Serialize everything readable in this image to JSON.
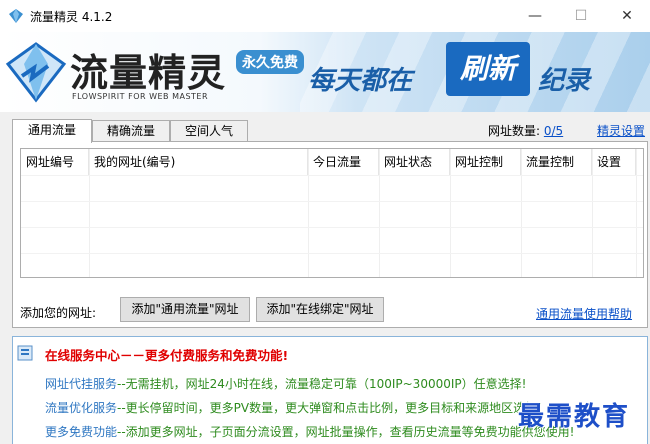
{
  "window": {
    "title": "流量精灵 4.1.2",
    "icon": "diamond-app-icon",
    "controls": {
      "minimize": "—",
      "maximize": "☐",
      "close": "✕"
    }
  },
  "banner": {
    "brand": "流量精灵",
    "subtitle": "FLOWSPIRIT FOR WEB MASTER",
    "free_badge": "永久免费",
    "slogan_a": "每天都在",
    "slogan_b": "刷新",
    "slogan_c": "纪录",
    "colors": {
      "brand_blue": "#1a6ac0",
      "accent": "#3a8fd0"
    }
  },
  "tabs": [
    {
      "label": "通用流量",
      "active": true
    },
    {
      "label": "精确流量",
      "active": false
    },
    {
      "label": "空间人气",
      "active": false
    }
  ],
  "url_count": {
    "label": "网址数量:",
    "value": "0/5"
  },
  "settings_link": "精灵设置",
  "table": {
    "columns": [
      "网址编号",
      "我的网址(编号)",
      "今日流量",
      "网址状态",
      "网址控制",
      "流量控制",
      "设置"
    ],
    "rows": []
  },
  "add_url": {
    "label": "添加您的网址:",
    "button_general": "添加\"通用流量\"网址",
    "button_bind": "添加\"在线绑定\"网址"
  },
  "help_link": "通用流量使用帮助",
  "service": {
    "title": "在线服务中心－－更多付费服务和免费功能!",
    "lines": [
      {
        "key": "网址代挂服务",
        "text": "--无需挂机，网址24小时在线，流量稳定可靠（100IP~30000IP）任意选择!"
      },
      {
        "key": "流量优化服务",
        "text": "--更长停留时间，更多PV数量，更大弹窗和点击比例，更多目标和来源地区选择!"
      },
      {
        "key": "更多免费功能",
        "text": "--添加更多网址，子页面分流设置，网址批量操作，查看历史流量等免费功能供您使用!"
      }
    ],
    "colors": {
      "title": "#e00000",
      "key": "#2f77c2",
      "text": "#2e8b1e"
    }
  },
  "watermark": "最需教育"
}
